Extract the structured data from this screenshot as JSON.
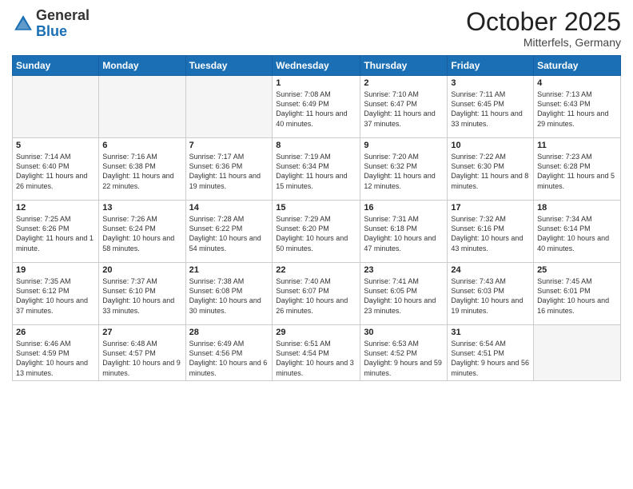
{
  "header": {
    "logo_general": "General",
    "logo_blue": "Blue",
    "month_title": "October 2025",
    "location": "Mitterfels, Germany"
  },
  "days_of_week": [
    "Sunday",
    "Monday",
    "Tuesday",
    "Wednesday",
    "Thursday",
    "Friday",
    "Saturday"
  ],
  "weeks": [
    [
      {
        "day": "",
        "info": ""
      },
      {
        "day": "",
        "info": ""
      },
      {
        "day": "",
        "info": ""
      },
      {
        "day": "1",
        "info": "Sunrise: 7:08 AM\nSunset: 6:49 PM\nDaylight: 11 hours and 40 minutes."
      },
      {
        "day": "2",
        "info": "Sunrise: 7:10 AM\nSunset: 6:47 PM\nDaylight: 11 hours and 37 minutes."
      },
      {
        "day": "3",
        "info": "Sunrise: 7:11 AM\nSunset: 6:45 PM\nDaylight: 11 hours and 33 minutes."
      },
      {
        "day": "4",
        "info": "Sunrise: 7:13 AM\nSunset: 6:43 PM\nDaylight: 11 hours and 29 minutes."
      }
    ],
    [
      {
        "day": "5",
        "info": "Sunrise: 7:14 AM\nSunset: 6:40 PM\nDaylight: 11 hours and 26 minutes."
      },
      {
        "day": "6",
        "info": "Sunrise: 7:16 AM\nSunset: 6:38 PM\nDaylight: 11 hours and 22 minutes."
      },
      {
        "day": "7",
        "info": "Sunrise: 7:17 AM\nSunset: 6:36 PM\nDaylight: 11 hours and 19 minutes."
      },
      {
        "day": "8",
        "info": "Sunrise: 7:19 AM\nSunset: 6:34 PM\nDaylight: 11 hours and 15 minutes."
      },
      {
        "day": "9",
        "info": "Sunrise: 7:20 AM\nSunset: 6:32 PM\nDaylight: 11 hours and 12 minutes."
      },
      {
        "day": "10",
        "info": "Sunrise: 7:22 AM\nSunset: 6:30 PM\nDaylight: 11 hours and 8 minutes."
      },
      {
        "day": "11",
        "info": "Sunrise: 7:23 AM\nSunset: 6:28 PM\nDaylight: 11 hours and 5 minutes."
      }
    ],
    [
      {
        "day": "12",
        "info": "Sunrise: 7:25 AM\nSunset: 6:26 PM\nDaylight: 11 hours and 1 minute."
      },
      {
        "day": "13",
        "info": "Sunrise: 7:26 AM\nSunset: 6:24 PM\nDaylight: 10 hours and 58 minutes."
      },
      {
        "day": "14",
        "info": "Sunrise: 7:28 AM\nSunset: 6:22 PM\nDaylight: 10 hours and 54 minutes."
      },
      {
        "day": "15",
        "info": "Sunrise: 7:29 AM\nSunset: 6:20 PM\nDaylight: 10 hours and 50 minutes."
      },
      {
        "day": "16",
        "info": "Sunrise: 7:31 AM\nSunset: 6:18 PM\nDaylight: 10 hours and 47 minutes."
      },
      {
        "day": "17",
        "info": "Sunrise: 7:32 AM\nSunset: 6:16 PM\nDaylight: 10 hours and 43 minutes."
      },
      {
        "day": "18",
        "info": "Sunrise: 7:34 AM\nSunset: 6:14 PM\nDaylight: 10 hours and 40 minutes."
      }
    ],
    [
      {
        "day": "19",
        "info": "Sunrise: 7:35 AM\nSunset: 6:12 PM\nDaylight: 10 hours and 37 minutes."
      },
      {
        "day": "20",
        "info": "Sunrise: 7:37 AM\nSunset: 6:10 PM\nDaylight: 10 hours and 33 minutes."
      },
      {
        "day": "21",
        "info": "Sunrise: 7:38 AM\nSunset: 6:08 PM\nDaylight: 10 hours and 30 minutes."
      },
      {
        "day": "22",
        "info": "Sunrise: 7:40 AM\nSunset: 6:07 PM\nDaylight: 10 hours and 26 minutes."
      },
      {
        "day": "23",
        "info": "Sunrise: 7:41 AM\nSunset: 6:05 PM\nDaylight: 10 hours and 23 minutes."
      },
      {
        "day": "24",
        "info": "Sunrise: 7:43 AM\nSunset: 6:03 PM\nDaylight: 10 hours and 19 minutes."
      },
      {
        "day": "25",
        "info": "Sunrise: 7:45 AM\nSunset: 6:01 PM\nDaylight: 10 hours and 16 minutes."
      }
    ],
    [
      {
        "day": "26",
        "info": "Sunrise: 6:46 AM\nSunset: 4:59 PM\nDaylight: 10 hours and 13 minutes."
      },
      {
        "day": "27",
        "info": "Sunrise: 6:48 AM\nSunset: 4:57 PM\nDaylight: 10 hours and 9 minutes."
      },
      {
        "day": "28",
        "info": "Sunrise: 6:49 AM\nSunset: 4:56 PM\nDaylight: 10 hours and 6 minutes."
      },
      {
        "day": "29",
        "info": "Sunrise: 6:51 AM\nSunset: 4:54 PM\nDaylight: 10 hours and 3 minutes."
      },
      {
        "day": "30",
        "info": "Sunrise: 6:53 AM\nSunset: 4:52 PM\nDaylight: 9 hours and 59 minutes."
      },
      {
        "day": "31",
        "info": "Sunrise: 6:54 AM\nSunset: 4:51 PM\nDaylight: 9 hours and 56 minutes."
      },
      {
        "day": "",
        "info": ""
      }
    ]
  ]
}
